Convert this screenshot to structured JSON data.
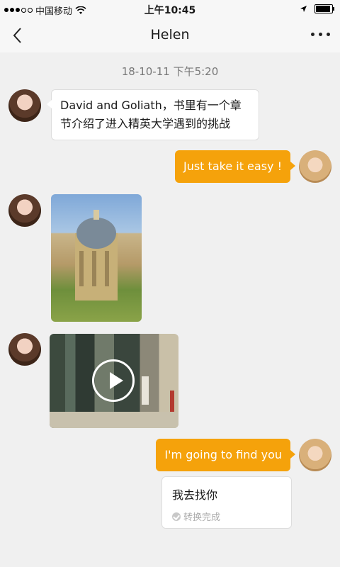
{
  "status_bar": {
    "carrier": "中国移动",
    "time": "上午10:45"
  },
  "nav": {
    "title": "Helen"
  },
  "chat": {
    "timestamp": "18-10-11  下午5:20",
    "messages": [
      {
        "from": "Helen",
        "type": "text",
        "text": "David and Goliath，书里有一个章节介绍了进入精英大学遇到的挑战"
      },
      {
        "from": "me",
        "type": "text",
        "text": "Just take it easy !"
      },
      {
        "from": "Helen",
        "type": "image"
      },
      {
        "from": "Helen",
        "type": "video"
      },
      {
        "from": "me",
        "type": "text",
        "text": "I'm going to find you"
      },
      {
        "from": "me",
        "type": "transcription",
        "text": "我去找你",
        "status": "转换完成"
      }
    ]
  },
  "colors": {
    "accent": "#f5a20b",
    "background": "#f0f0f0"
  }
}
